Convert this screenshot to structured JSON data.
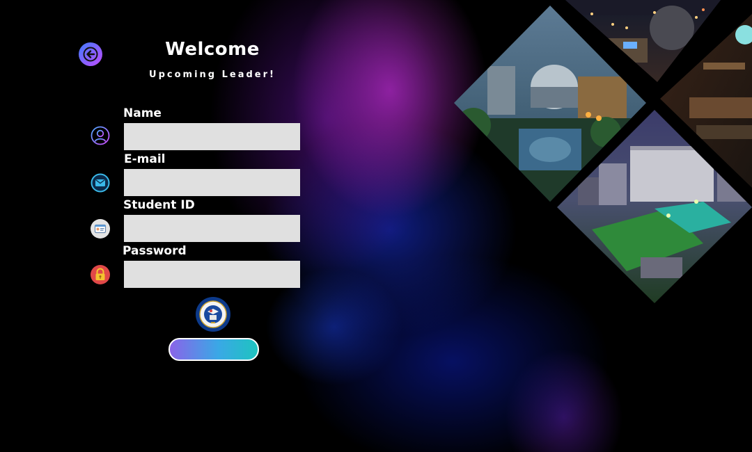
{
  "header": {
    "title": "Welcome",
    "subtitle": "Upcoming Leader!"
  },
  "form": {
    "name_label": "Name",
    "email_label": "E-mail",
    "student_id_label": "Student ID",
    "password_label": "Password",
    "name_value": "",
    "email_value": "",
    "student_id_value": "",
    "password_value": "",
    "submit_label": ""
  },
  "icons": {
    "back": "back-arrow-icon",
    "user": "user-icon",
    "email": "envelope-icon",
    "student_id": "id-card-icon",
    "password": "lock-icon"
  },
  "colors": {
    "field_bg": "#e0e0e0",
    "accent_purple": "#c14cff",
    "accent_blue": "#3f7bff",
    "accent_teal": "#1ec4c0"
  }
}
